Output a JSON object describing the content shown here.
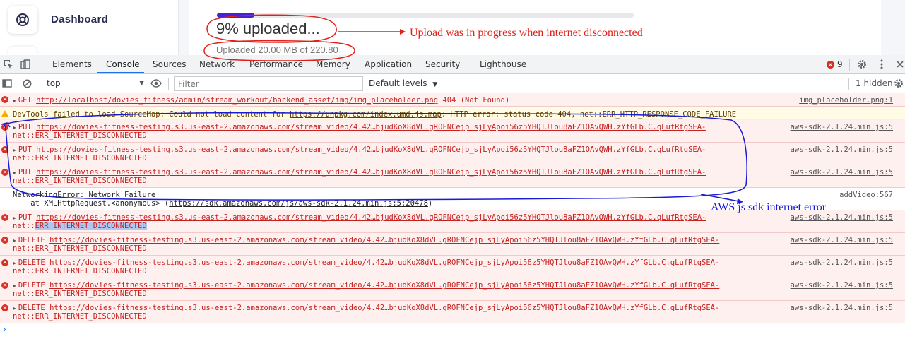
{
  "app": {
    "sidebar": {
      "nav_label": "Dashboard",
      "nav_icon": "lifebuoy-icon"
    },
    "upload": {
      "progress_fraction": 0.09,
      "percent_text": "9% uploaded...",
      "size_text": "Uploaded 20.00 MB of 220.80"
    }
  },
  "devtools": {
    "tabs": [
      "Elements",
      "Console",
      "Sources",
      "Network",
      "Performance",
      "Memory",
      "Application",
      "Security",
      "Lighthouse"
    ],
    "active_tab": "Console",
    "error_count": "9",
    "toolbar": {
      "context": "top",
      "filter_placeholder": "Filter",
      "levels_label": "Default levels",
      "hidden_label": "1 hidden"
    },
    "messages": [
      {
        "level": "error",
        "method": "GET",
        "url": "http://localhost/dovies_fitness/admin/stream_workout/backend_asset/img/img_placeholder.png",
        "tail": "404 (Not Found)",
        "source": "img_placeholder.png:1"
      },
      {
        "level": "warning",
        "pre": "DevTools failed to load SourceMap: Could not load content for ",
        "url": "https://unpkg.com/index.umd.js.map",
        "tail": ": HTTP error: status code 404, net::ERR_HTTP_RESPONSE_CODE_FAILURE"
      },
      {
        "level": "error",
        "method": "PUT",
        "url": "https://dovies-fitness-testing.s3.us-east-2.amazonaws.com/stream_video/4.42…bjudKoX8dVL.gROFNCejp_sjLyApoi56z5YHQTJlou8aFZ1OAvQWH.zYfGLb.C.qLufRtgSEA-",
        "line2": "net::ERR_INTERNET_DISCONNECTED",
        "source": "aws-sdk-2.1.24.min.js:5"
      },
      {
        "level": "error",
        "method": "PUT",
        "url": "https://dovies-fitness-testing.s3.us-east-2.amazonaws.com/stream_video/4.42…bjudKoX8dVL.gROFNCejp_sjLyApoi56z5YHQTJlou8aFZ1OAvQWH.zYfGLb.C.qLufRtgSEA-",
        "line2": "net::ERR_INTERNET_DISCONNECTED",
        "source": "aws-sdk-2.1.24.min.js:5"
      },
      {
        "level": "error",
        "method": "PUT",
        "url": "https://dovies-fitness-testing.s3.us-east-2.amazonaws.com/stream_video/4.42…bjudKoX8dVL.gROFNCejp_sjLyApoi56z5YHQTJlou8aFZ1OAvQWH.zYfGLb.C.qLufRtgSEA-",
        "line2": "net::ERR_INTERNET_DISCONNECTED",
        "source": "aws-sdk-2.1.24.min.js:5"
      },
      {
        "level": "log",
        "text": "NetworkingError: Network Failure",
        "stack_pre": "    at XMLHttpRequest.<anonymous> (",
        "stack_url": "https://sdk.amazonaws.com/js/aws-sdk-2.1.24.min.js:5:20478",
        "stack_post": ")",
        "source": "addVideo:567"
      },
      {
        "level": "error",
        "method": "PUT",
        "url": "https://dovies-fitness-testing.s3.us-east-2.amazonaws.com/stream_video/4.42…bjudKoX8dVL.gROFNCejp_sjLyApoi56z5YHQTJlou8aFZ1OAvQWH.zYfGLb.C.qLufRtgSEA-",
        "line2_pre": "net::",
        "line2_hl": "ERR_INTERNET_DISCONNECTED",
        "source": "aws-sdk-2.1.24.min.js:5"
      },
      {
        "level": "error",
        "method": "DELETE",
        "url": "https://dovies-fitness-testing.s3.us-east-2.amazonaws.com/stream_video/4.42…bjudKoX8dVL.gROFNCejp_sjLyApoi56z5YHQTJlou8aFZ1OAvQWH.zYfGLb.C.qLufRtgSEA-",
        "line2": "net::ERR_INTERNET_DISCONNECTED",
        "source": "aws-sdk-2.1.24.min.js:5"
      },
      {
        "level": "error",
        "method": "DELETE",
        "url": "https://dovies-fitness-testing.s3.us-east-2.amazonaws.com/stream_video/4.42…bjudKoX8dVL.gROFNCejp_sjLyApoi56z5YHQTJlou8aFZ1OAvQWH.zYfGLb.C.qLufRtgSEA-",
        "line2": "net::ERR_INTERNET_DISCONNECTED",
        "source": "aws-sdk-2.1.24.min.js:5"
      },
      {
        "level": "error",
        "method": "DELETE",
        "url": "https://dovies-fitness-testing.s3.us-east-2.amazonaws.com/stream_video/4.42…bjudKoX8dVL.gROFNCejp_sjLyApoi56z5YHQTJlou8aFZ1OAvQWH.zYfGLb.C.qLufRtgSEA-",
        "line2": "net::ERR_INTERNET_DISCONNECTED",
        "source": "aws-sdk-2.1.24.min.js:5"
      },
      {
        "level": "error",
        "method": "DELETE",
        "url": "https://dovies-fitness-testing.s3.us-east-2.amazonaws.com/stream_video/4.42…bjudKoX8dVL.gROFNCejp_sjLyApoi56z5YHQTJlou8aFZ1OAvQWH.zYfGLb.C.qLufRtgSEA-",
        "line2": "net::ERR_INTERNET_DISCONNECTED",
        "source": "aws-sdk-2.1.24.min.js:5"
      }
    ]
  },
  "annotations": {
    "red_note": "Upload was in progress when internet disconnected",
    "blue_note": "AWS js sdk internet error",
    "red_color": "#e0201b",
    "blue_color": "#1a1ad6"
  }
}
